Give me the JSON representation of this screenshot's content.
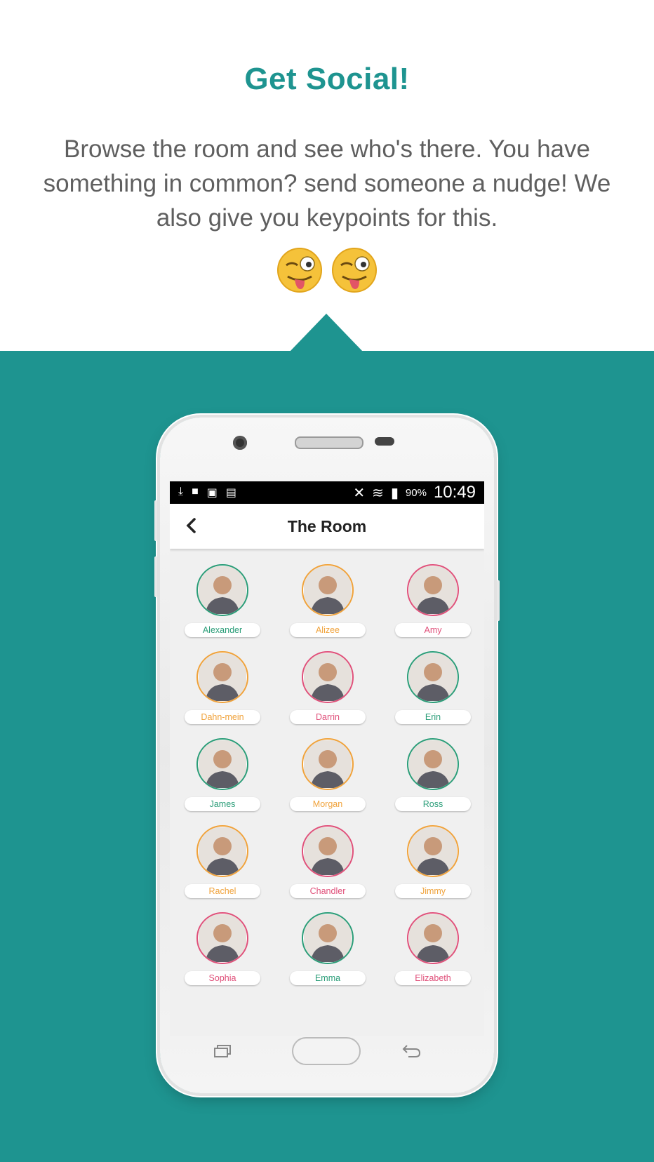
{
  "header": {
    "title": "Get Social!",
    "description": "Browse the room and see who's there. You have something in common? send someone a nudge! We also give you keypoints for this."
  },
  "emojis": [
    "winking-face-with-tongue-icon",
    "winking-face-with-tongue-icon"
  ],
  "colors": {
    "accent": "#1e9490",
    "orange": "#f0a23a",
    "pink": "#e0507a",
    "green": "#2a9d78"
  },
  "status_bar": {
    "battery": "90%",
    "time": "10:49"
  },
  "app_bar": {
    "title": "The Room",
    "back_icon": "chevron-left-icon"
  },
  "people": [
    {
      "name": "Alexander",
      "color": "#2a9d78"
    },
    {
      "name": "Alizee",
      "color": "#f0a23a"
    },
    {
      "name": "Amy",
      "color": "#e0507a"
    },
    {
      "name": "Dahn-mein",
      "color": "#f0a23a"
    },
    {
      "name": "Darrin",
      "color": "#e0507a"
    },
    {
      "name": "Erin",
      "color": "#2a9d78"
    },
    {
      "name": "James",
      "color": "#2a9d78"
    },
    {
      "name": "Morgan",
      "color": "#f0a23a"
    },
    {
      "name": "Ross",
      "color": "#2a9d78"
    },
    {
      "name": "Rachel",
      "color": "#f0a23a"
    },
    {
      "name": "Chandler",
      "color": "#e0507a"
    },
    {
      "name": "Jimmy",
      "color": "#f0a23a"
    },
    {
      "name": "Sophia",
      "color": "#e0507a"
    },
    {
      "name": "Emma",
      "color": "#2a9d78"
    },
    {
      "name": "Elizabeth",
      "color": "#e0507a"
    }
  ],
  "nav_icons": [
    "recent-apps-icon",
    "home-button",
    "back-arrow-icon"
  ]
}
